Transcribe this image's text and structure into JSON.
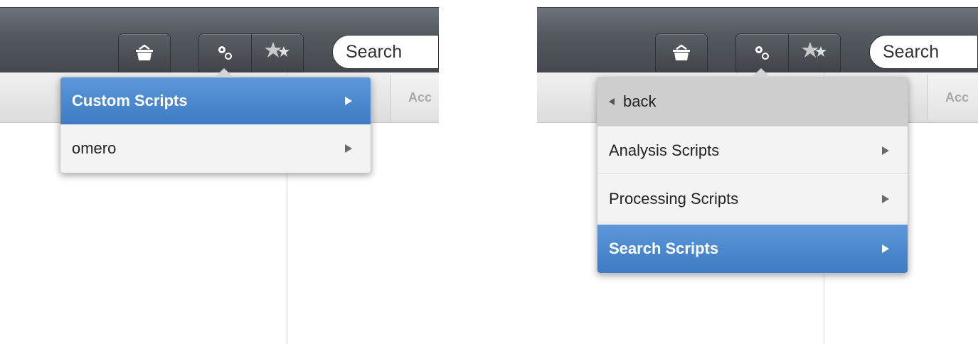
{
  "search": {
    "placeholder": "Search"
  },
  "tab_label": "Acc",
  "left_menu": {
    "items": [
      {
        "label": "Custom Scripts",
        "selected": true
      },
      {
        "label": "omero",
        "selected": false
      }
    ]
  },
  "right_menu": {
    "back_label": "back",
    "items": [
      {
        "label": "Analysis Scripts",
        "selected": false
      },
      {
        "label": "Processing Scripts",
        "selected": false
      },
      {
        "label": "Search Scripts",
        "selected": true
      }
    ]
  },
  "icons": [
    "basket-icon",
    "gears-icon",
    "stars-icon",
    "chevron-right-icon",
    "back-triangle-icon"
  ],
  "colors": {
    "selected": "#4a89cf",
    "toolbar": "#50555c"
  }
}
